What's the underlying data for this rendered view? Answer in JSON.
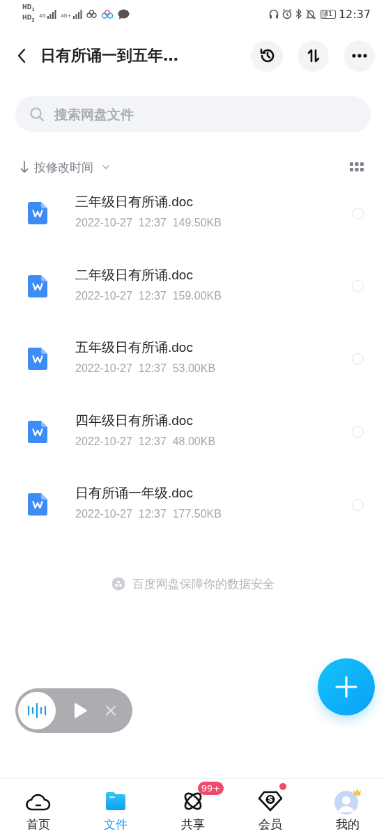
{
  "status_bar": {
    "sims": [
      "HD$_{1}$",
      "HD$_{2}$"
    ],
    "networks": [
      "4G",
      "4G+"
    ],
    "battery": "41",
    "time": "12:37"
  },
  "header": {
    "title": "日有所诵一到五年…"
  },
  "search": {
    "placeholder": "搜索网盘文件"
  },
  "sort": {
    "label": "按修改时间"
  },
  "files": [
    {
      "name": "三年级日有所诵.doc",
      "date": "2022-10-27",
      "time": "12:37",
      "size": "149.50KB",
      "selected": false
    },
    {
      "name": "二年级日有所诵.doc",
      "date": "2022-10-27",
      "time": "12:37",
      "size": "159.00KB",
      "selected": false
    },
    {
      "name": "五年级日有所诵.doc",
      "date": "2022-10-27",
      "time": "12:37",
      "size": "53.00KB",
      "selected": false
    },
    {
      "name": "四年级日有所诵.doc",
      "date": "2022-10-27",
      "time": "12:37",
      "size": "48.00KB",
      "selected": false
    },
    {
      "name": "日有所诵一年级.doc",
      "date": "2022-10-27",
      "time": "12:37",
      "size": "177.50KB",
      "selected": false
    }
  ],
  "notice": "百度网盘保障你的数据安全",
  "nav": [
    {
      "kind": "home",
      "label": "首页",
      "selected": false
    },
    {
      "kind": "files",
      "label": "文件",
      "selected": true
    },
    {
      "kind": "share",
      "label": "共享",
      "selected": false,
      "badge": "99+"
    },
    {
      "kind": "vip",
      "label": "会员",
      "selected": false,
      "dot": true
    },
    {
      "kind": "me",
      "label": "我的",
      "selected": false
    }
  ]
}
